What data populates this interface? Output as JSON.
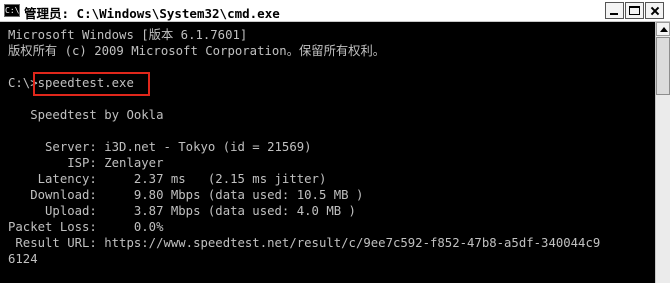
{
  "window": {
    "icon_label": "C:\\",
    "title": "管理员: C:\\Windows\\System32\\cmd.exe"
  },
  "console": {
    "lines": [
      "Microsoft Windows [版本 6.1.7601]",
      "版权所有 (c) 2009 Microsoft Corporation。保留所有权利。",
      "",
      "C:\\>speedtest.exe",
      "",
      "   Speedtest by Ookla",
      "",
      "     Server: i3D.net - Tokyo (id = 21569)",
      "        ISP: Zenlayer",
      "    Latency:     2.37 ms   (2.15 ms jitter)",
      "   Download:     9.80 Mbps (data used: 10.5 MB )",
      "     Upload:     3.87 Mbps (data used: 4.0 MB )",
      "Packet Loss:     0.0%",
      " Result URL: https://www.speedtest.net/result/c/9ee7c592-f852-47b8-a5df-340044c9",
      "6124"
    ]
  }
}
